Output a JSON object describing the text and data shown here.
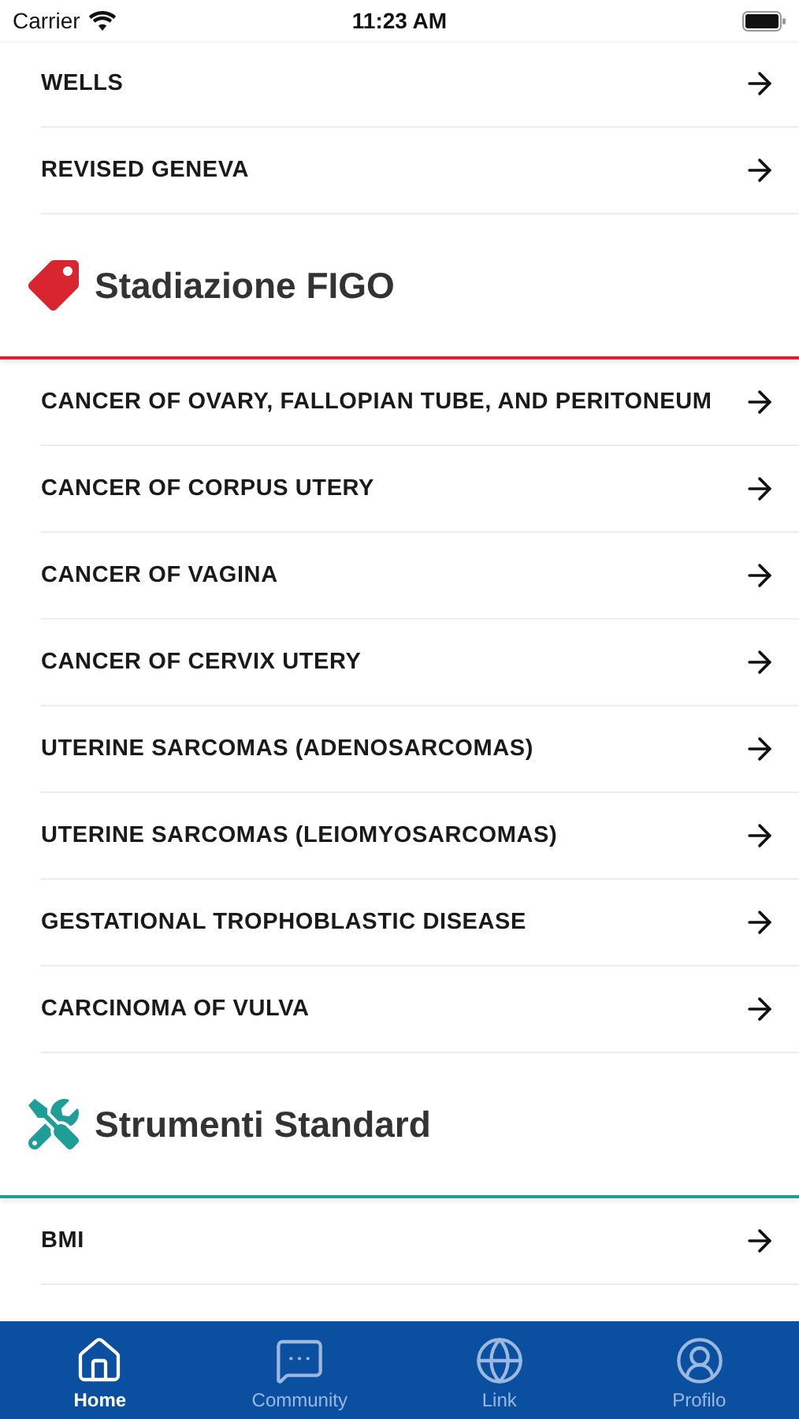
{
  "status_bar": {
    "carrier": "Carrier",
    "time": "11:23 AM"
  },
  "top_items": [
    {
      "label": "WELLS"
    },
    {
      "label": "REVISED GENEVA"
    }
  ],
  "sections": [
    {
      "title": "Stadiazione FIGO",
      "kind": "tag",
      "color": "#d9252f",
      "items": [
        {
          "label": "CANCER OF OVARY, FALLOPIAN TUBE, AND PERITONEUM"
        },
        {
          "label": "CANCER OF CORPUS UTERY"
        },
        {
          "label": "CANCER OF VAGINA"
        },
        {
          "label": "CANCER OF CERVIX UTERY"
        },
        {
          "label": "UTERINE SARCOMAS (ADENOSARCOMAS)"
        },
        {
          "label": "UTERINE SARCOMAS (LEIOMYOSARCOMAS)"
        },
        {
          "label": "GESTATIONAL TROPHOBLASTIC DISEASE"
        },
        {
          "label": "CARCINOMA OF VULVA"
        }
      ]
    },
    {
      "title": "Strumenti Standard",
      "kind": "tools",
      "color": "#1f9e97",
      "items": [
        {
          "label": "BMI"
        }
      ]
    }
  ],
  "tab_bar": [
    {
      "label": "Home",
      "kind": "home",
      "selected": true
    },
    {
      "label": "Community",
      "kind": "chat",
      "selected": false
    },
    {
      "label": "Link",
      "kind": "globe",
      "selected": false
    },
    {
      "label": "Profilo",
      "kind": "profile",
      "selected": false
    }
  ]
}
